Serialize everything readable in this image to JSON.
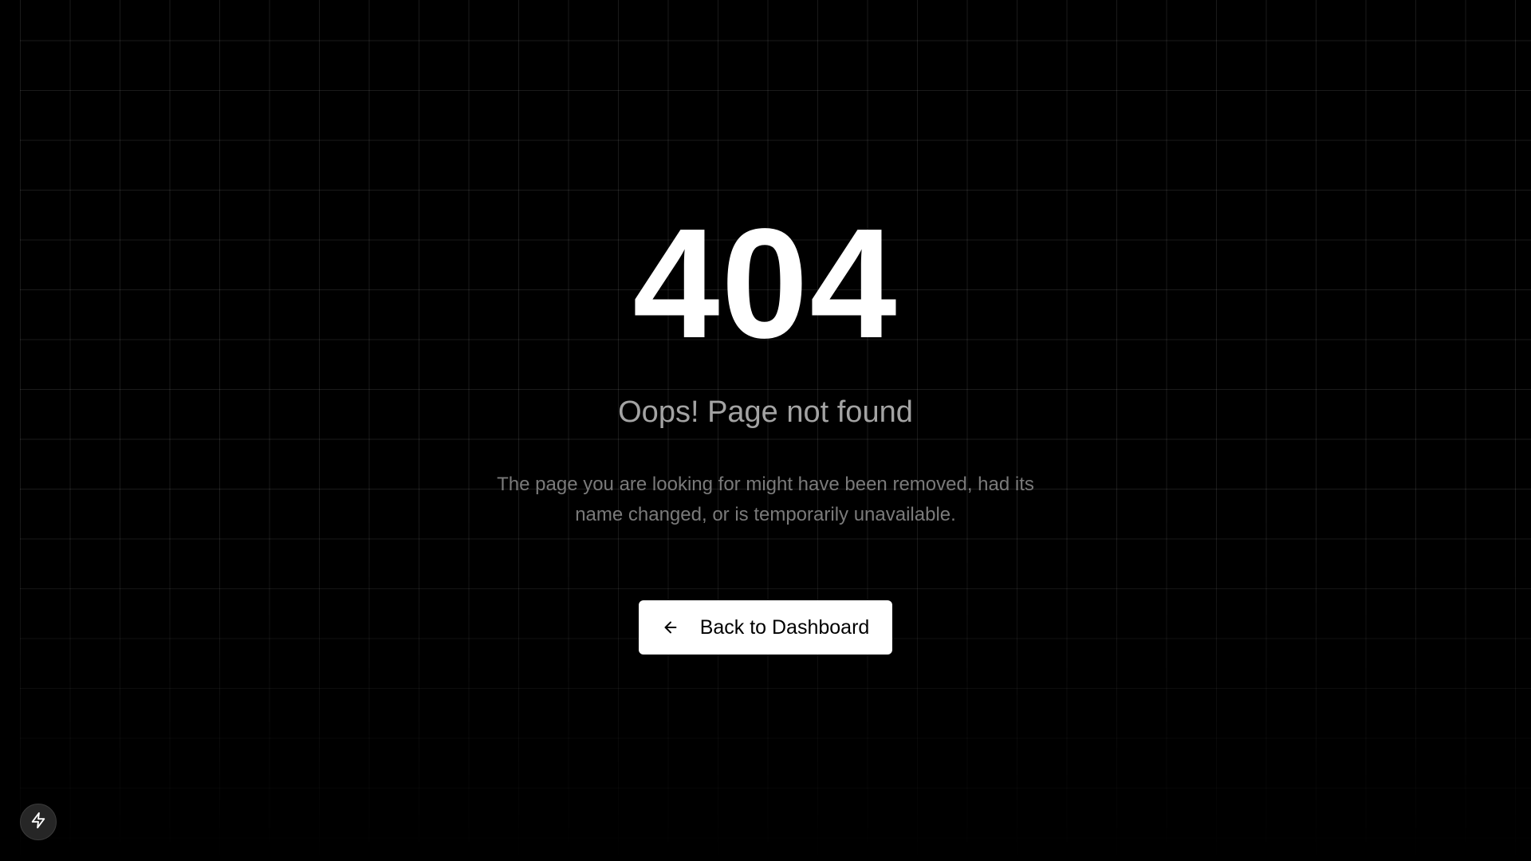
{
  "error": {
    "code": "404",
    "headline": "Oops! Page not found",
    "description": "The page you are looking for might have been removed, had its name changed, or is temporarily unavailable."
  },
  "actions": {
    "back_label": "Back to Dashboard",
    "back_icon": "arrow-left-icon"
  },
  "floating_button": {
    "icon": "lightning-bolt-icon"
  },
  "colors": {
    "background": "#000000",
    "code": "#ffffff",
    "headline": "#a3a3a3",
    "description": "#7a7a7a",
    "button_bg": "#ffffff",
    "button_text": "#000000",
    "fab_bg": "#262626"
  }
}
